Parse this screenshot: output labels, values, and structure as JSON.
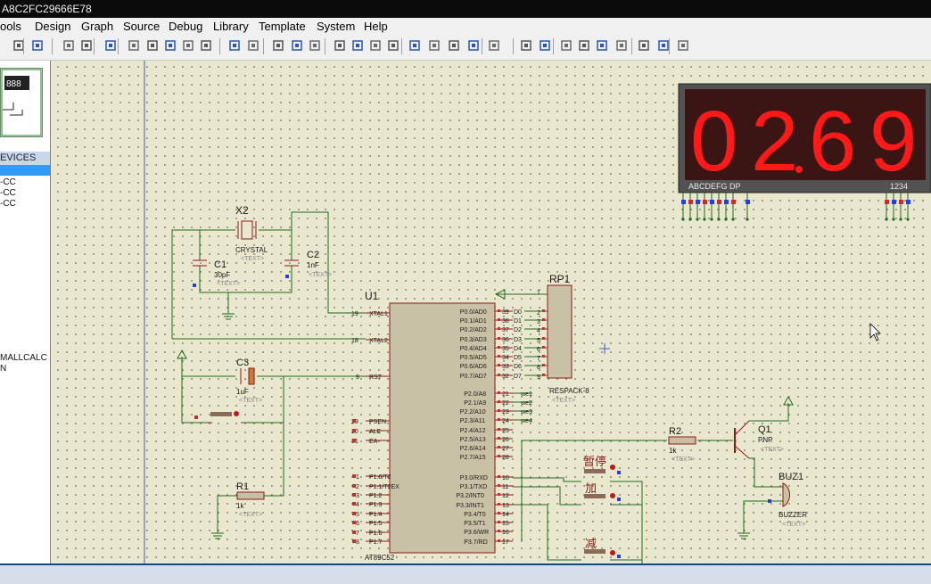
{
  "window": {
    "title": "A8C2FC29666E78"
  },
  "menu": {
    "items": [
      "ools",
      "Design",
      "Graph",
      "Source",
      "Debug",
      "Library",
      "Template",
      "System",
      "Help"
    ]
  },
  "toolbar": {
    "icons": [
      "print-icon",
      "page-icon",
      "refresh-icon",
      "grid-icon",
      "origin-icon",
      "pan-icon",
      "zoom-in-icon",
      "zoom-out-icon",
      "zoom-all-icon",
      "zoom-area-icon",
      "undo-icon",
      "redo-icon",
      "cut-icon",
      "copy-icon",
      "paste-icon",
      "block-copy-icon",
      "block-move-icon",
      "block-rotate-icon",
      "block-delete-icon",
      "pick-device-icon",
      "make-device-icon",
      "packaging-icon",
      "decompose-icon",
      "wire-autorouter-icon",
      "search-icon",
      "property-tool-icon",
      "design-explorer-icon",
      "new-sheet-icon",
      "remove-sheet-icon",
      "exit-sheet-icon",
      "bom-icon",
      "erc-icon",
      "netlist-icon",
      "ares-icon"
    ]
  },
  "left_panel": {
    "devices_header": "EVICES",
    "devices": [
      "-CC",
      "-CC",
      "-CC",
      "MALLCALC",
      "N"
    ]
  },
  "display": {
    "digits": [
      "0",
      "2",
      "6",
      "9"
    ],
    "pin_label_left": "ABCDEFG  DP",
    "pin_label_right": "1234",
    "color": "#ff1a1a"
  },
  "schematic": {
    "u1": {
      "ref": "U1",
      "part": "AT89C52",
      "text": "<TEXT>",
      "left_pins": [
        {
          "num": "19",
          "name": "XTAL1"
        },
        {
          "num": "18",
          "name": "XTAL2"
        },
        {
          "num": "9",
          "name": "RST"
        },
        {
          "num": "29",
          "name": "PSEN"
        },
        {
          "num": "30",
          "name": "ALE"
        },
        {
          "num": "31",
          "name": "EA"
        },
        {
          "num": "1",
          "name": "P1.0/T2"
        },
        {
          "num": "2",
          "name": "P1.1/T2EX"
        },
        {
          "num": "3",
          "name": "P1.2"
        },
        {
          "num": "4",
          "name": "P1.3"
        },
        {
          "num": "5",
          "name": "P1.4"
        },
        {
          "num": "6",
          "name": "P1.5"
        },
        {
          "num": "7",
          "name": "P1.6"
        },
        {
          "num": "8",
          "name": "P1.7"
        }
      ],
      "right_pins": [
        {
          "num": "39",
          "name": "P0.0/AD0",
          "net": "D0"
        },
        {
          "num": "38",
          "name": "P0.1/AD1",
          "net": "D1"
        },
        {
          "num": "37",
          "name": "P0.2/AD2",
          "net": "D2"
        },
        {
          "num": "36",
          "name": "P0.3/AD3",
          "net": "D3"
        },
        {
          "num": "35",
          "name": "P0.4/AD4",
          "net": "D4"
        },
        {
          "num": "34",
          "name": "P0.5/AD5",
          "net": "D5"
        },
        {
          "num": "33",
          "name": "P0.6/AD6",
          "net": "D6"
        },
        {
          "num": "32",
          "name": "P0.7/AD7",
          "net": "D7"
        },
        {
          "num": "21",
          "name": "P2.0/A8",
          "net": "we1"
        },
        {
          "num": "22",
          "name": "P2.1/A9",
          "net": "we2"
        },
        {
          "num": "23",
          "name": "P2.2/A10",
          "net": "we3"
        },
        {
          "num": "24",
          "name": "P2.3/A11",
          "net": "we4"
        },
        {
          "num": "25",
          "name": "P2.4/A12",
          "net": ""
        },
        {
          "num": "26",
          "name": "P2.5/A13",
          "net": ""
        },
        {
          "num": "27",
          "name": "P2.6/A14",
          "net": ""
        },
        {
          "num": "28",
          "name": "P2.7/A15",
          "net": ""
        },
        {
          "num": "10",
          "name": "P3.0/RXD",
          "net": ""
        },
        {
          "num": "11",
          "name": "P3.1/TXD",
          "net": ""
        },
        {
          "num": "12",
          "name": "P3.2/INT0",
          "net": ""
        },
        {
          "num": "13",
          "name": "P3.3/INT1",
          "net": ""
        },
        {
          "num": "14",
          "name": "P3.4/T0",
          "net": ""
        },
        {
          "num": "15",
          "name": "P3.5/T1",
          "net": ""
        },
        {
          "num": "16",
          "name": "P3.6/WR",
          "net": ""
        },
        {
          "num": "17",
          "name": "P3.7/RD",
          "net": ""
        }
      ]
    },
    "x2": {
      "ref": "X2",
      "part": "CRYSTAL",
      "text": "<TEXT>"
    },
    "c1": {
      "ref": "C1",
      "value": "30pF",
      "text": "<TEXT>"
    },
    "c2": {
      "ref": "C2",
      "value": "1nF",
      "text": "<TEXT>"
    },
    "c3": {
      "ref": "C3",
      "value": "1uF",
      "text": "<TEXT>"
    },
    "r1": {
      "ref": "R1",
      "value": "1k",
      "text": "<TEXT>"
    },
    "r2": {
      "ref": "R2",
      "value": "1k",
      "text": "<TEXT>"
    },
    "rp1": {
      "ref": "RP1",
      "part": "RESPACK-8",
      "text": "<TEXT>"
    },
    "q1": {
      "ref": "Q1",
      "part": "PNP",
      "text": "<TEXT>"
    },
    "buz1": {
      "ref": "BUZ1",
      "part": "BUZZER",
      "text": "<TEXT>"
    },
    "buttons": [
      "暂停",
      "加",
      "减"
    ]
  }
}
